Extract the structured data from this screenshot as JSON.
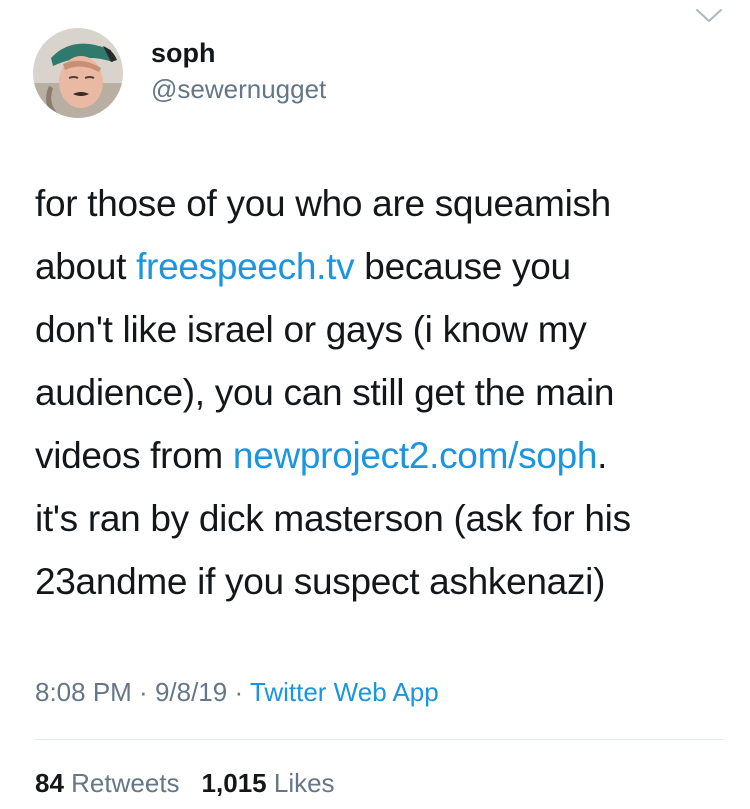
{
  "author": {
    "name": "soph",
    "handle": "@sewernugget"
  },
  "tweet": {
    "lines": [
      [
        {
          "text": "for those of you who are squeamish"
        }
      ],
      [
        {
          "text": "about "
        },
        {
          "text": "freespeech.tv",
          "link": true
        },
        {
          "text": " because you"
        }
      ],
      [
        {
          "text": "don't like israel or gays (i know my"
        }
      ],
      [
        {
          "text": "audience), you can still get the main"
        }
      ],
      [
        {
          "text": "videos from "
        },
        {
          "text": "newproject2.com/soph",
          "link": true
        },
        {
          "text": "."
        }
      ],
      [
        {
          "text": "it's ran by dick masterson (ask for his"
        }
      ],
      [
        {
          "text": "23andme if you suspect ashkenazi)"
        }
      ]
    ]
  },
  "meta": {
    "time": "8:08 PM",
    "sep1": " · ",
    "date": "9/8/19",
    "sep2": " · ",
    "source": "Twitter Web App"
  },
  "stats": {
    "retweets_count": "84",
    "retweets_label": "Retweets",
    "likes_count": "1,015",
    "likes_label": "Likes"
  },
  "colors": {
    "link": "#1b95e0",
    "secondary_text": "#657786",
    "primary_text": "#14171a"
  },
  "icons": {
    "avatar": "profile-photo",
    "chevron": "chevron-down-icon"
  }
}
